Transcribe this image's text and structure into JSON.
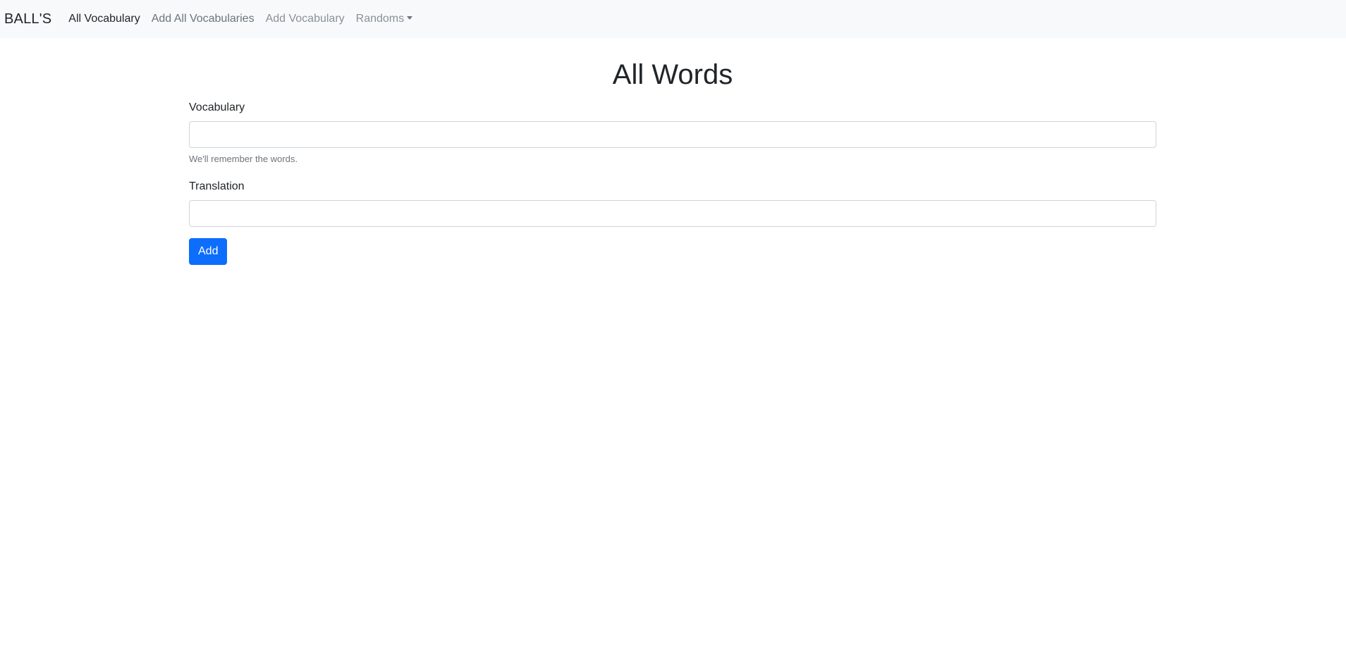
{
  "navbar": {
    "brand": "BALL'S",
    "links": [
      {
        "label": "All Vocabulary"
      },
      {
        "label": "Add All Vocabularies"
      },
      {
        "label": "Add Vocabulary"
      },
      {
        "label": "Randoms"
      }
    ]
  },
  "page": {
    "title": "All Words"
  },
  "form": {
    "vocabulary_label": "Vocabulary",
    "vocabulary_value": "",
    "vocabulary_help": "We'll remember the words.",
    "translation_label": "Translation",
    "translation_value": "",
    "submit_label": "Add"
  },
  "colors": {
    "navbar_bg": "#f8f9fa",
    "primary": "#0d6efd"
  },
  "icons": {
    "dropdown": "caret-down-icon"
  }
}
